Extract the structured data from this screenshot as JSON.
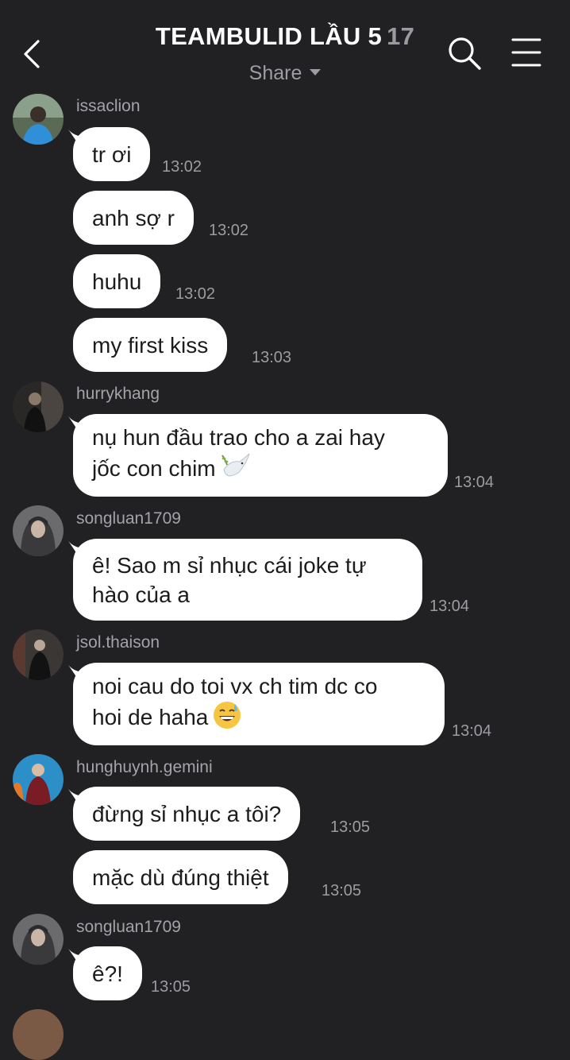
{
  "header": {
    "title": "TEAMBULID LẦU 5",
    "member_count": "17",
    "share_label": "Share"
  },
  "messages": [
    {
      "user": "issaclion",
      "texts": [
        {
          "text": "tr ơi",
          "time": "13:02"
        },
        {
          "text": "anh sợ r",
          "time": "13:02"
        },
        {
          "text": "huhu",
          "time": "13:02"
        },
        {
          "text": "my first kiss",
          "time": "13:03"
        }
      ]
    },
    {
      "user": "hurrykhang",
      "texts": [
        {
          "line1": "nụ hun đầu trao cho a zai hay",
          "line2": "jốc con chim",
          "emoji": "dove",
          "time": "13:04"
        }
      ]
    },
    {
      "user": "songluan1709",
      "texts": [
        {
          "line1": "ê! Sao m sỉ nhục cái joke tự",
          "line2": "hào của a",
          "time": "13:04"
        }
      ]
    },
    {
      "user": "jsol.thaison",
      "texts": [
        {
          "line1": "noi cau do toi vx ch tim dc co",
          "line2": "hoi de haha",
          "emoji": "grinning-sweat",
          "time": "13:04"
        }
      ]
    },
    {
      "user": "hunghuynh.gemini",
      "texts": [
        {
          "text": "đừng sỉ nhục a tôi?",
          "time": "13:05"
        },
        {
          "text": "mặc dù đúng thiệt",
          "time": "13:05"
        }
      ]
    },
    {
      "user": "songluan1709",
      "texts": [
        {
          "text": "ê?!",
          "time": "13:05"
        }
      ]
    }
  ],
  "icons": {
    "back": "chevron-left-icon",
    "search": "search-icon",
    "menu": "hamburger-menu-icon"
  },
  "colors": {
    "background": "#212124",
    "bubble": "#ffffff",
    "meta_text": "#9c9ca1"
  }
}
